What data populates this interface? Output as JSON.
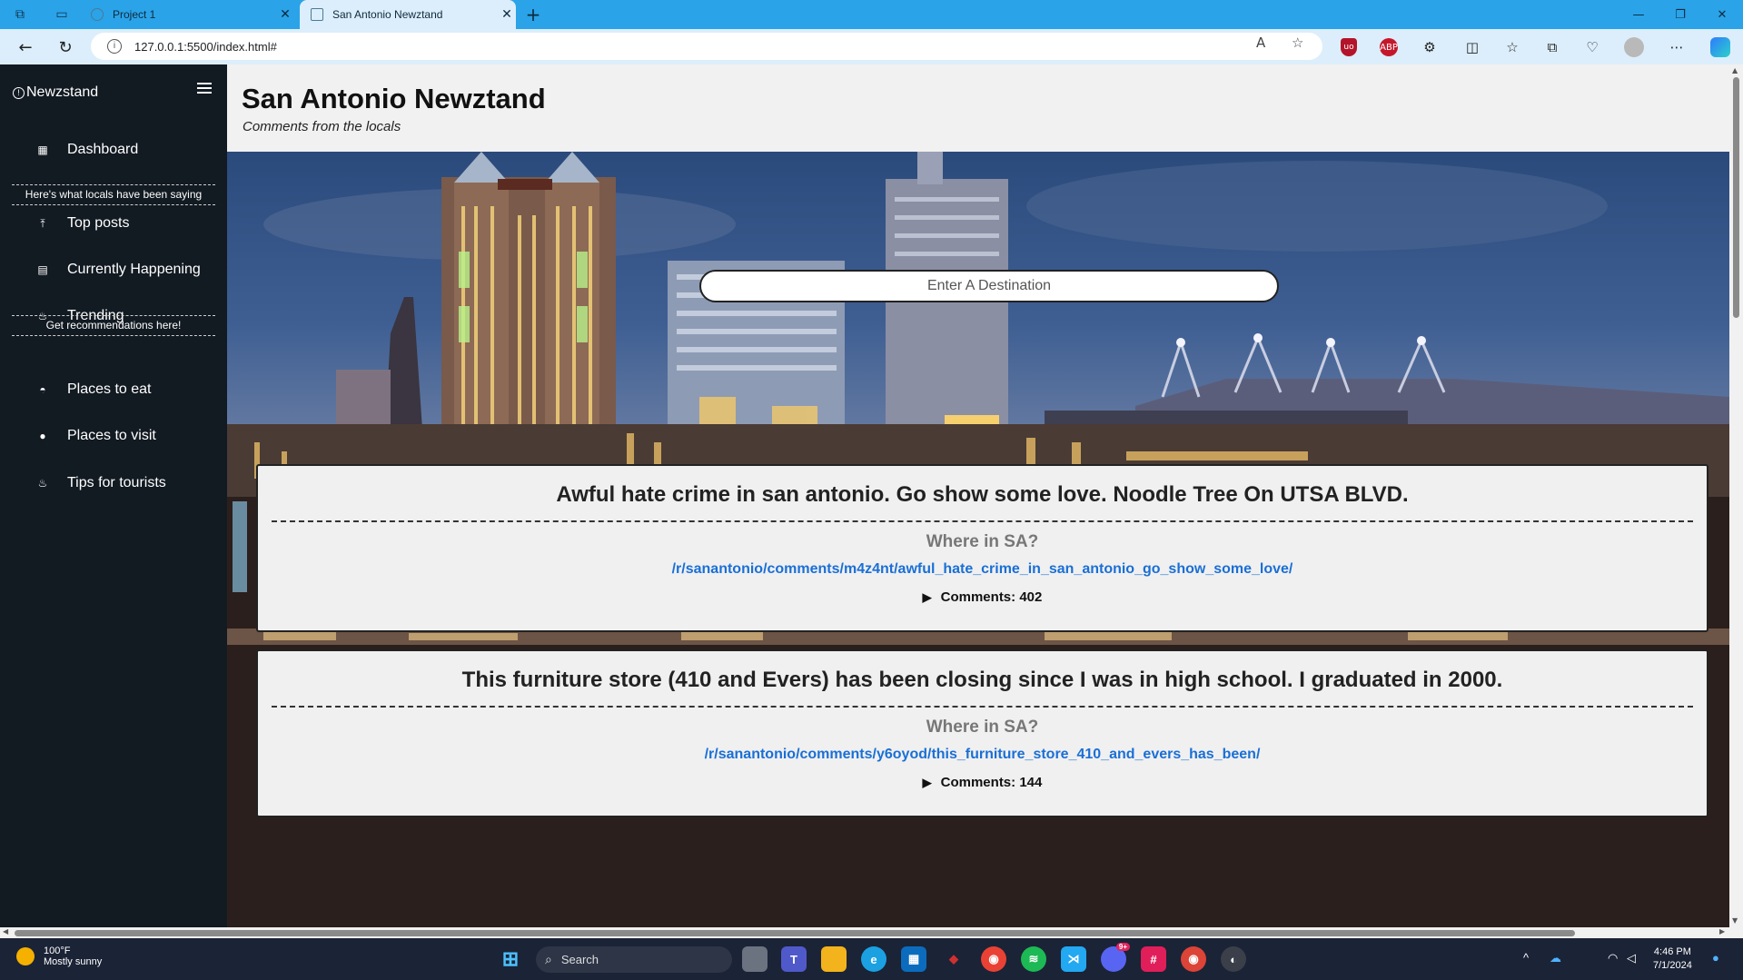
{
  "browser": {
    "tabs": [
      {
        "title": "Project 1",
        "active": false
      },
      {
        "title": "San Antonio Newztand",
        "active": true
      }
    ],
    "url": "127.0.0.1:5500/index.html#"
  },
  "sidebar": {
    "brand": "Newzstand",
    "dashboard": "Dashboard",
    "section1": "Here's what locals have been saying",
    "items1": [
      "Top posts",
      "Currently Happening",
      "Trending"
    ],
    "section2": "Get recommendations here!",
    "items2": [
      "Places to eat",
      "Places to visit",
      "Tips for tourists"
    ]
  },
  "header": {
    "title": "San Antonio Newztand",
    "subtitle": "Comments from the locals"
  },
  "search": {
    "placeholder": "Enter A Destination"
  },
  "posts": [
    {
      "title": "Awful hate crime in san antonio. Go show some love. Noodle Tree On UTSA BLVD.",
      "where_label": "Where in SA?",
      "link": "/r/sanantonio/comments/m4z4nt/awful_hate_crime_in_san_antonio_go_show_some_love/",
      "comments": "Comments: 402"
    },
    {
      "title": "This furniture store (410 and Evers) has been closing since I was in high school. I graduated in 2000.",
      "where_label": "Where in SA?",
      "link": "/r/sanantonio/comments/y6oyod/this_furniture_store_410_and_evers_has_been/",
      "comments": "Comments: 144"
    }
  ],
  "taskbar": {
    "weather_temp": "100°F",
    "weather_desc": "Mostly sunny",
    "search_label": "Search",
    "time": "4:46 PM",
    "date": "7/1/2024",
    "discord_badge": "9+"
  },
  "colors": {
    "tabbar": "#2aa3e8",
    "sidebar": "#121a22",
    "link": "#1a6fd6",
    "taskbar": "#1b2336"
  }
}
